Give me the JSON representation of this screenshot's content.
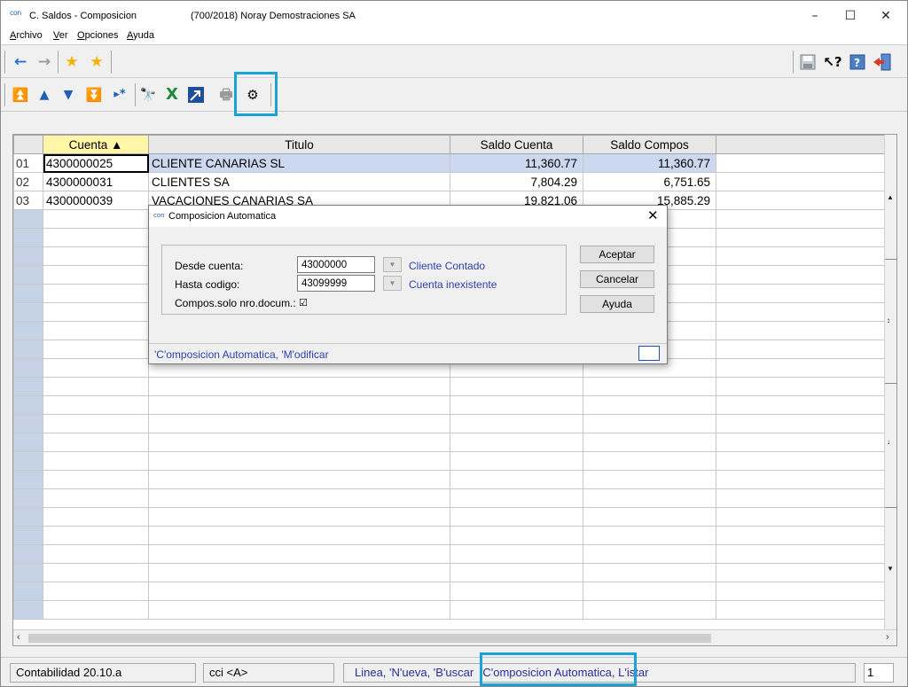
{
  "window": {
    "title": "C. Saldos - Composicion",
    "company": "(700/2018) Noray Demostraciones SA",
    "logo": "con",
    "controls": {
      "minimize": "–",
      "maximize": "☐",
      "close": "✕"
    }
  },
  "menu": [
    "Archivo",
    "Ver",
    "Opciones",
    "Ayuda"
  ],
  "toolbar1": {
    "back_icon": "arrow-left-icon",
    "forward_icon": "arrow-right-icon",
    "favorite_icon": "star-icon",
    "favorites_icon": "star-add-icon",
    "right_icons": [
      "save-icon",
      "help-pointer-icon",
      "help-book-icon",
      "exit-door-icon"
    ]
  },
  "toolbar2": {
    "icons": [
      "first-record-icon",
      "previous-record-icon",
      "next-record-icon",
      "last-record-icon",
      "new-record-icon",
      "binoculars-icon",
      "excel-icon",
      "export-icon",
      "print-icon",
      "settings-gears-icon"
    ]
  },
  "grid": {
    "columns": [
      "Cuenta ▲",
      "Titulo",
      "Saldo Cuenta",
      "Saldo Compos"
    ],
    "rows": [
      {
        "num": "01",
        "cuenta": "4300000025",
        "titulo": "CLIENTE CANARIAS SL",
        "saldo_cuenta": "11,360.77",
        "saldo_compos": "11,360.77"
      },
      {
        "num": "02",
        "cuenta": "4300000031",
        "titulo": "CLIENTES SA",
        "saldo_cuenta": "7,804.29",
        "saldo_compos": "6,751.65"
      },
      {
        "num": "03",
        "cuenta": "4300000039",
        "titulo": "VACACIONES CANARIAS SA",
        "saldo_cuenta": "19,821.06",
        "saldo_compos": "15,885.29"
      }
    ]
  },
  "dialog": {
    "title": "Composicion Automatica",
    "logo": "con",
    "close": "✕",
    "desde_label": "Desde cuenta:",
    "desde_value": "43000000",
    "desde_desc": "Cliente Contado",
    "hasta_label": "Hasta codigo:",
    "hasta_value": "43099999",
    "hasta_desc": "Cuenta inexistente",
    "compos_label": "Compos.solo nro.docum.:",
    "compos_check": "☑",
    "dropdown_glyph": "▼",
    "buttons": {
      "accept": "Aceptar",
      "cancel": "Cancelar",
      "help": "Ayuda"
    },
    "status": "'C'omposicion Automatica, 'M'odificar"
  },
  "statusbar": {
    "version": "Contabilidad 20.10.a",
    "user": "cci <A>",
    "hint_prefix": "Linea, 'N'ueva, 'B'uscar",
    "hint_highlight": "'C'omposicion Automatica,",
    "hint_suffix": "L'istar",
    "page": "1"
  },
  "colors": {
    "highlight": "#1aa3d6",
    "selection": "#cbd8ef",
    "link": "#2f3fb0"
  }
}
